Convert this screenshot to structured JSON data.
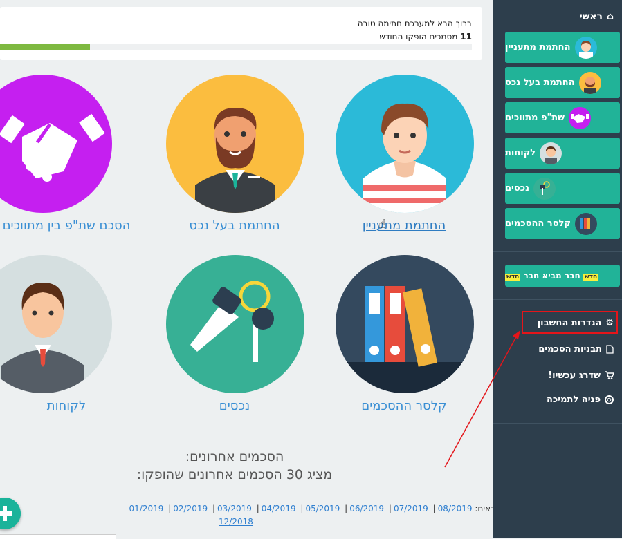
{
  "welcome": {
    "greeting": "ברוך הבא למערכת חתימה טובה",
    "count": "11",
    "count_text": "מסמכים הופקו החודש",
    "progress_fraction": 0.19
  },
  "sidebar": {
    "home_label": "ראשי",
    "buttons": [
      {
        "label": "החתמת מתעניין"
      },
      {
        "label": "החתמת בעל נכס"
      },
      {
        "label": "שת\"פ מתווכים"
      },
      {
        "label": "לקוחות"
      },
      {
        "label": "נכסים"
      },
      {
        "label": "קלסר ההסכמים"
      }
    ],
    "referral": {
      "badge": "חדש",
      "label": "חבר מביא חבר"
    },
    "menu": [
      {
        "label": "הגדרות החשבון",
        "icon": "gear-icon"
      },
      {
        "label": "תבניות הסכמים",
        "icon": "file-icon"
      },
      {
        "label": "שדרג עכשיו!",
        "icon": "cart-icon"
      },
      {
        "label": "פניה לתמיכה",
        "icon": "lifebuoy-icon"
      }
    ]
  },
  "tiles": [
    {
      "label": "החתמת מתעניין"
    },
    {
      "label": "החתמת בעל נכס"
    },
    {
      "label": "הסכם שת\"פ בין מתווכים"
    },
    {
      "label": "קלסר ההסכמים"
    },
    {
      "label": "נכסים"
    },
    {
      "label": "לקוחות"
    }
  ],
  "recent": {
    "title": "הסכמים אחרונים:",
    "subtitle": "מציג 30 הסכמים אחרונים שהופקו:",
    "months_intro": "ניתן גם לצפות בחודשים הבאים:",
    "months": [
      "08/2019",
      "07/2019",
      "06/2019",
      "05/2019",
      "04/2019",
      "03/2019",
      "02/2019",
      "01/2019"
    ],
    "months_extra": "12/2018"
  },
  "colors": {
    "sidebar_bg": "#2d3e4c",
    "accent_green": "#21b398",
    "link_blue": "#2f7fd0",
    "highlight_red": "#e4151a"
  }
}
